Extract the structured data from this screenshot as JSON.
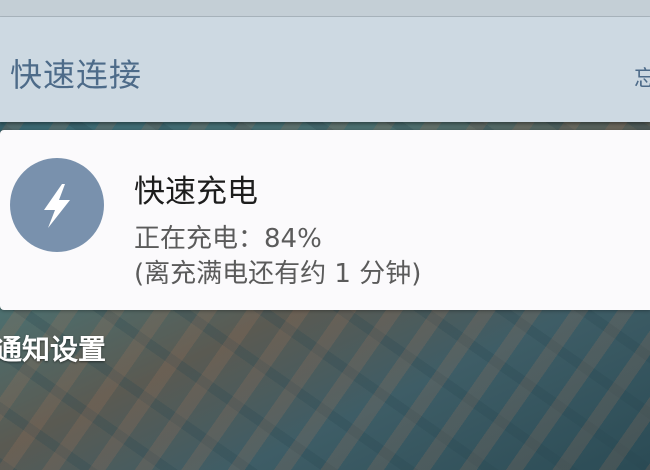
{
  "quick_connect": {
    "title": "快速连接",
    "edge_glyph": "忘"
  },
  "notification": {
    "icon": "lightning-bolt-icon",
    "title": "快速充电",
    "line1": "正在充电：84%",
    "line2": "(离充满电还有约 1 分钟)",
    "charge_percent": 84
  },
  "footer": {
    "settings_label": "通知设置"
  },
  "colors": {
    "header_bg": "#cdd9e2",
    "header_text": "#4d6b89",
    "card_bg": "#fbfafc",
    "icon_bg": "#7991ad"
  }
}
